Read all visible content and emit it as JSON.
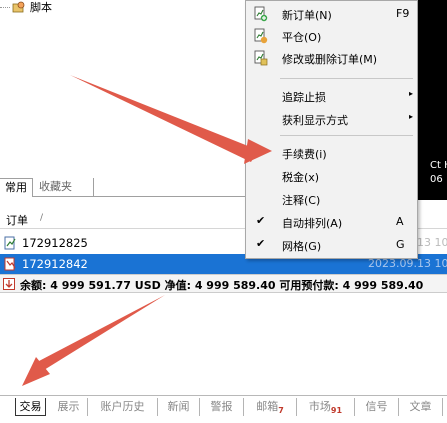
{
  "navigator": {
    "item_label": "脚本",
    "tabs": [
      "常用",
      "收藏夹"
    ]
  },
  "chart": {
    "label1": "Ct H",
    "label2": "06"
  },
  "terminal": {
    "column_order": "订单",
    "sort_mark": "/",
    "rows": [
      {
        "ticket": "172912825",
        "time": "2023.09.13 10"
      },
      {
        "ticket": "172912842",
        "time": "2023.09.13 10"
      }
    ],
    "balance_line": "余额: 4 999 591.77 USD  净值: 4 999 589.40  可用预付款: 4 999 589.40"
  },
  "context_menu": {
    "items": [
      {
        "label": "新订单(N)",
        "shortcut": "F9",
        "icon": "new-order-icon"
      },
      {
        "label": "平仓(O)",
        "icon": "close-position-icon"
      },
      {
        "label": "修改或删除订单(M)",
        "icon": "modify-order-icon"
      },
      {
        "label": "追踪止损",
        "submenu": true
      },
      {
        "label": "获利显示方式",
        "submenu": true
      },
      {
        "label": "手续费(i)"
      },
      {
        "label": "税金(x)"
      },
      {
        "label": "注释(C)"
      },
      {
        "label": "自动排列(A)",
        "shortcut": "A",
        "checked": true
      },
      {
        "label": "网格(G)",
        "shortcut": "G",
        "checked": true
      }
    ],
    "check_mark": "✔",
    "submenu_arrow": "▸"
  },
  "bottom_tabs": [
    {
      "label": "交易",
      "active": true
    },
    {
      "label": "展示"
    },
    {
      "label": "账户历史"
    },
    {
      "label": "新闻"
    },
    {
      "label": "警报"
    },
    {
      "label": "邮箱",
      "badge": "7"
    },
    {
      "label": "市场",
      "badge": "91"
    },
    {
      "label": "信号"
    },
    {
      "label": "文章"
    }
  ],
  "colors": {
    "selected_row": "#1a73d4",
    "arrow": "#e05a4a",
    "menu_bg": "#f2f2f2"
  }
}
